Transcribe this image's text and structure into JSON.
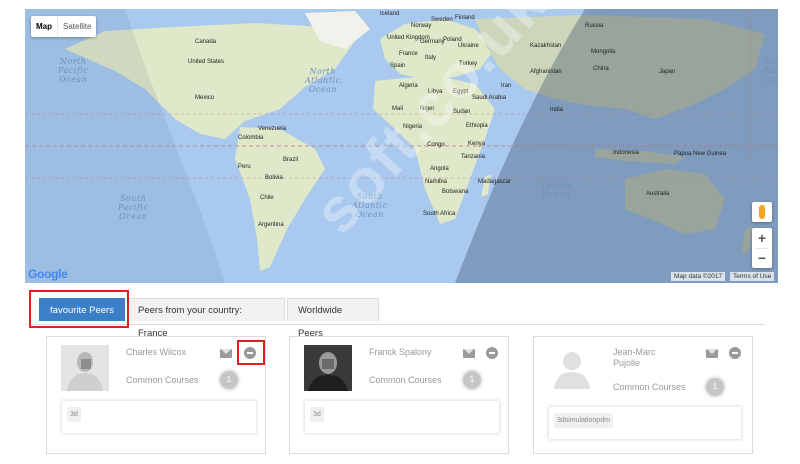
{
  "map": {
    "type_map": "Map",
    "type_satellite": "Satellite",
    "oceans": {
      "north_pacific_w": "North\nPacific\nOcean",
      "north_atlantic": "North\nAtlantic\nOcean",
      "south_pacific": "South\nPacific\nOcean",
      "south_atlantic": "South\nAtlantic\nOcean",
      "indian": "Indian\nOcean",
      "north_pacific_e": "North\nPacific\nOcean"
    },
    "countries": [
      "Iceland",
      "Sweden",
      "Finland",
      "Norway",
      "Russia",
      "Canada",
      "United Kingdom",
      "Germany",
      "Poland",
      "Ukraine",
      "Kazakhstan",
      "Mongolia",
      "France",
      "Italy",
      "Spain",
      "Turkey",
      "China",
      "United States",
      "Afghanistan",
      "Japan",
      "Algeria",
      "Libya",
      "Egypt",
      "Saudi Arabia",
      "Iran",
      "Mexico",
      "Mali",
      "Niger",
      "Sudan",
      "India",
      "Venezuela",
      "Nigeria",
      "Ethiopia",
      "Colombia",
      "Congo",
      "Kenya",
      "Brazil",
      "Tanzania",
      "Indonesia",
      "Papua New Guinea",
      "Peru",
      "Angola",
      "Bolivia",
      "Namibia",
      "Madagascar",
      "Chile",
      "South Africa",
      "Australia",
      "Argentina",
      "Botswana"
    ],
    "google": "Google",
    "map_data": "Map data ©2017",
    "terms": "Terms of Use",
    "zoom_in": "+",
    "zoom_out": "−"
  },
  "watermark": "soft.co.uk",
  "tabs": [
    {
      "label": "favourite Peers"
    },
    {
      "label": "Peers from your country: France"
    },
    {
      "label": "Worldwide Peers"
    }
  ],
  "peers": [
    {
      "name": "Charles Wilcox",
      "common_label": "Common Courses",
      "count": "1",
      "courses": [
        "3d"
      ]
    },
    {
      "name": "Franck Spalony",
      "common_label": "Common Courses",
      "count": "1",
      "courses": [
        "3d"
      ]
    },
    {
      "name": "Jean-Marc\nPujolle",
      "common_label": "Common Courses",
      "count": "1",
      "courses": [
        "3dsimulationpdm"
      ]
    }
  ],
  "colors": {
    "accent": "#3a7fc8",
    "highlight": "#e02020",
    "ocean": "#a9c9ee",
    "land": "#dfe8c8"
  }
}
